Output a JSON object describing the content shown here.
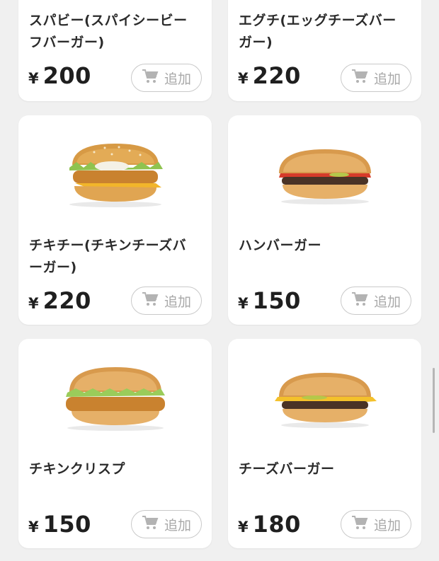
{
  "items": [
    {
      "name_line1": "スパビー(スパイシービー",
      "name_line2": "フバーガー)",
      "yen": "¥",
      "price": "200",
      "add_label": "追加",
      "icon": "cart-icon"
    },
    {
      "name_line1": "エグチ(エッグチーズバー",
      "name_line2": "ガー)",
      "yen": "¥",
      "price": "220",
      "add_label": "追加",
      "icon": "cart-icon"
    },
    {
      "name_line1": "チキチー(チキンチーズバ",
      "name_line2": "ーガー)",
      "yen": "¥",
      "price": "220",
      "add_label": "追加",
      "icon": "cart-icon",
      "image": "chicken-cheese-burger-image"
    },
    {
      "name_line1": "ハンバーガー",
      "name_line2": "",
      "yen": "¥",
      "price": "150",
      "add_label": "追加",
      "icon": "cart-icon",
      "image": "hamburger-image"
    },
    {
      "name_line1": "チキンクリスプ",
      "name_line2": "",
      "yen": "¥",
      "price": "150",
      "add_label": "追加",
      "icon": "cart-icon",
      "image": "chicken-crisp-image"
    },
    {
      "name_line1": "チーズバーガー",
      "name_line2": "",
      "yen": "¥",
      "price": "180",
      "add_label": "追加",
      "icon": "cart-icon",
      "image": "cheeseburger-image"
    }
  ],
  "colors": {
    "background": "#f0f0f0",
    "card": "#ffffff",
    "button_border": "#c9c9c9",
    "button_text": "#a8a8a8"
  }
}
